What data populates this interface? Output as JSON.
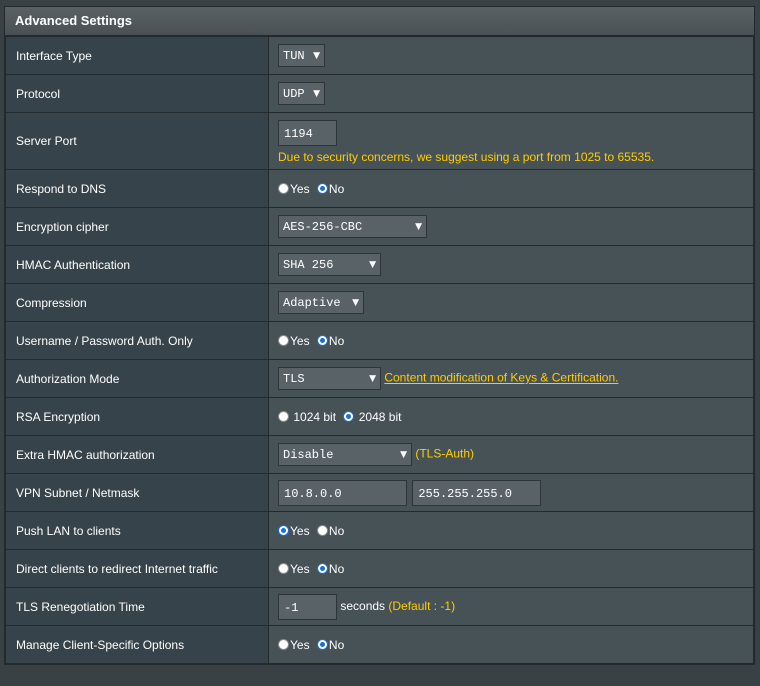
{
  "header": {
    "title": "Advanced Settings"
  },
  "rows": {
    "interface_type": {
      "label": "Interface Type",
      "value": "TUN"
    },
    "protocol": {
      "label": "Protocol",
      "value": "UDP"
    },
    "server_port": {
      "label": "Server Port",
      "value": "1194",
      "note": "Due to security concerns, we suggest using a port from 1025 to 65535."
    },
    "respond_dns": {
      "label": "Respond to DNS",
      "yes": "Yes",
      "no": "No",
      "selected": "No"
    },
    "encryption_cipher": {
      "label": "Encryption cipher",
      "value": "AES-256-CBC"
    },
    "hmac_auth": {
      "label": "HMAC Authentication",
      "value": "SHA 256"
    },
    "compression": {
      "label": "Compression",
      "value": "Adaptive"
    },
    "userpass_only": {
      "label": "Username / Password Auth. Only",
      "yes": "Yes",
      "no": "No",
      "selected": "No"
    },
    "auth_mode": {
      "label": "Authorization Mode",
      "value": "TLS",
      "link": "Content modification of Keys & Certification."
    },
    "rsa_encryption": {
      "label": "RSA Encryption",
      "opt1": "1024 bit",
      "opt2": "2048 bit",
      "selected": "2048 bit"
    },
    "extra_hmac": {
      "label": "Extra HMAC authorization",
      "value": "Disable",
      "hint": "(TLS-Auth)"
    },
    "vpn_subnet": {
      "label": "VPN Subnet / Netmask",
      "subnet": "10.8.0.0",
      "netmask": "255.255.255.0"
    },
    "push_lan": {
      "label": "Push LAN to clients",
      "yes": "Yes",
      "no": "No",
      "selected": "Yes"
    },
    "redirect_internet": {
      "label": "Direct clients to redirect Internet traffic",
      "yes": "Yes",
      "no": "No",
      "selected": "No"
    },
    "tls_reneg": {
      "label": "TLS Renegotiation Time",
      "value": "-1",
      "unit": "seconds",
      "hint": "(Default : -1)"
    },
    "client_specific": {
      "label": "Manage Client-Specific Options",
      "yes": "Yes",
      "no": "No",
      "selected": "No"
    }
  }
}
